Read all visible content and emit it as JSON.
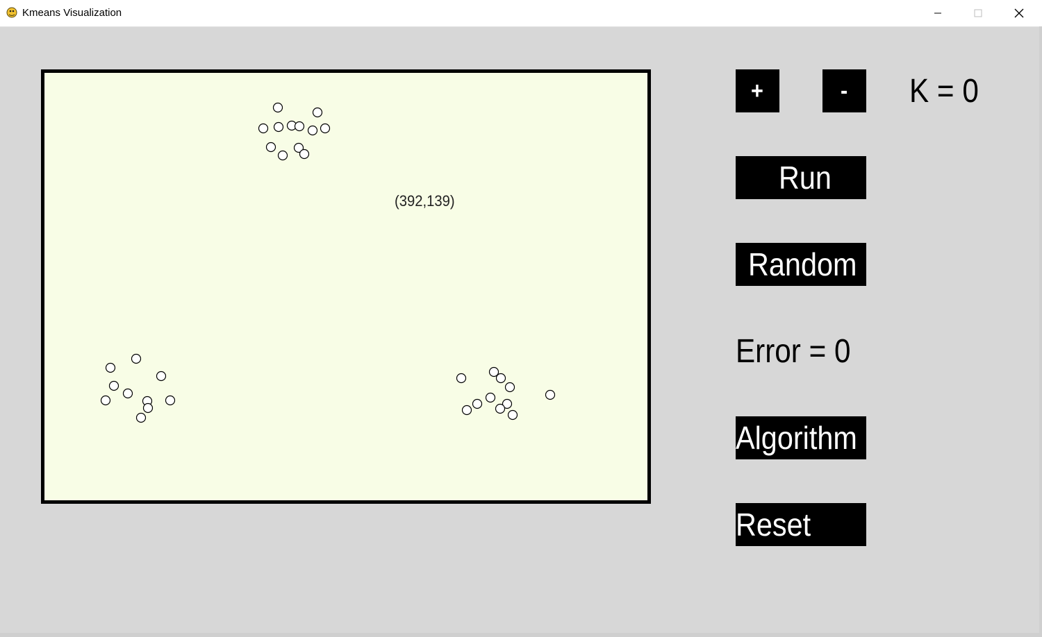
{
  "window": {
    "title": "Kmeans Visualization",
    "app_icon": "pygame-snake-icon"
  },
  "canvas": {
    "coordinate_readout": "(392,139)",
    "background": "#f8fde6",
    "point_fill": "#ffffff",
    "point_stroke": "#000000"
  },
  "controls": {
    "plus_label": "+",
    "minus_label": "-",
    "k_text": "K = 0",
    "run_label": "Run",
    "random_label": "Random",
    "error_text": "Error = 0",
    "algorithm_label": "Algorithm",
    "reset_label": "Reset"
  }
}
